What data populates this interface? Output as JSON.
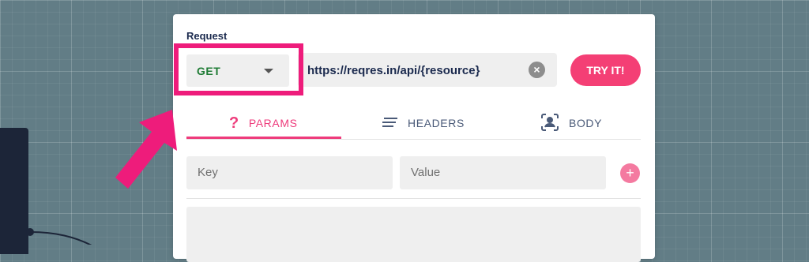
{
  "request": {
    "label": "Request",
    "method": "GET",
    "url": "https://reqres.in/api/{resource}",
    "try_label": "TRY IT!"
  },
  "tabs": [
    {
      "label": "PARAMS",
      "icon": "question-icon",
      "active": true
    },
    {
      "label": "HEADERS",
      "icon": "lines-icon",
      "active": false
    },
    {
      "label": "BODY",
      "icon": "user-focus-icon",
      "active": false
    }
  ],
  "params": {
    "key_placeholder": "Key",
    "value_placeholder": "Value",
    "add_icon": "+"
  },
  "colors": {
    "accent": "#ee3c7c",
    "method_green": "#1e7b34",
    "highlight": "#ee1c7b",
    "background": "#627d86"
  }
}
